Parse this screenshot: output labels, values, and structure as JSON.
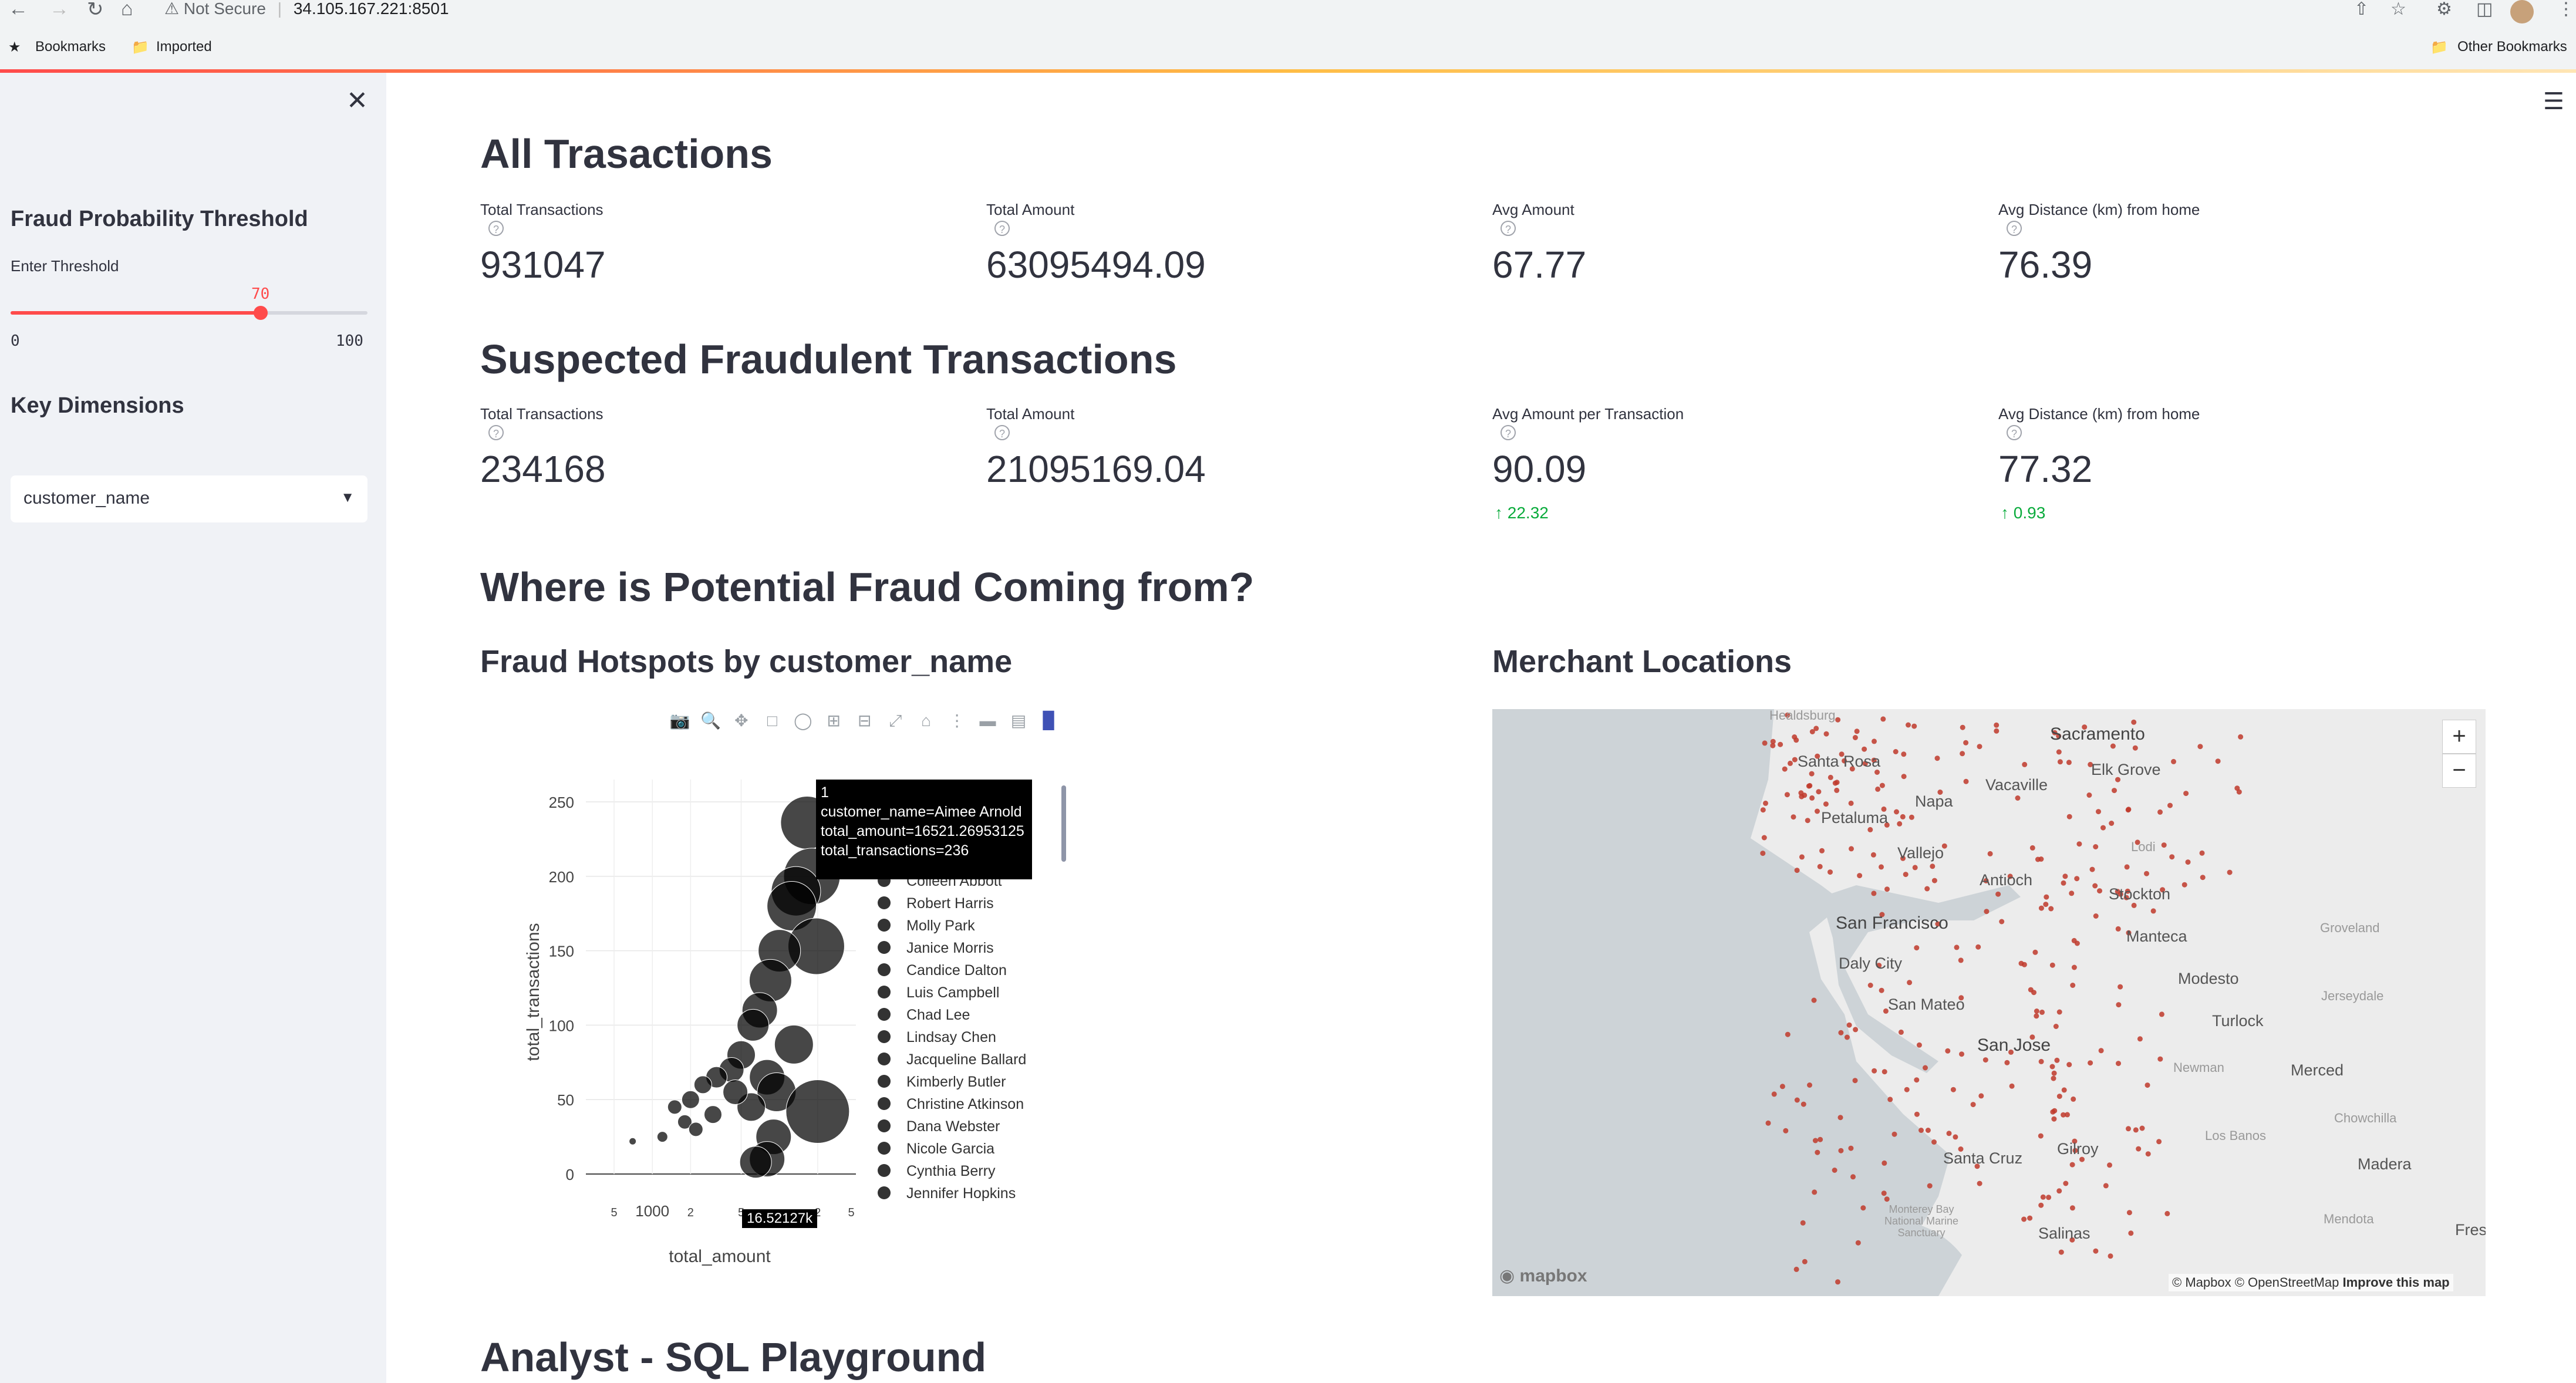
{
  "browser": {
    "security_label": "Not Secure",
    "url": "34.105.167.221:8501",
    "bookmarks": [
      "Bookmarks",
      "Imported"
    ],
    "other_bookmarks": "Other Bookmarks"
  },
  "sidebar": {
    "threshold_title": "Fraud Probability Threshold",
    "threshold_label": "Enter Threshold",
    "slider": {
      "value": "70",
      "min": "0",
      "max": "100",
      "fraction": 0.7
    },
    "dimensions_title": "Key Dimensions",
    "dimension_selected": "customer_name"
  },
  "all_transactions": {
    "title": "All Trasactions",
    "metrics": [
      {
        "label": "Total Transactions",
        "value": "931047"
      },
      {
        "label": "Total Amount",
        "value": "63095494.09"
      },
      {
        "label": "Avg Amount",
        "value": "67.77"
      },
      {
        "label": "Avg Distance (km) from home",
        "value": "76.39"
      }
    ]
  },
  "suspected": {
    "title": "Suspected Fraudulent Transactions",
    "metrics": [
      {
        "label": "Total Transactions",
        "value": "234168",
        "delta": ""
      },
      {
        "label": "Total Amount",
        "value": "21095169.04",
        "delta": ""
      },
      {
        "label": "Avg Amount per Transaction",
        "value": "90.09",
        "delta": "22.32"
      },
      {
        "label": "Avg Distance (km) from home",
        "value": "77.32",
        "delta": "0.93"
      }
    ]
  },
  "where_title": "Where is Potential Fraud Coming from?",
  "hotspots_title": "Fraud Hotspots by customer_name",
  "merchant_title": "Merchant Locations",
  "sql_title": "Analyst - SQL Playground",
  "tooltip": {
    "line1": "1",
    "line2": "customer_name=Aimee Arnold",
    "line3": "total_amount=16521.26953125",
    "line4": "total_transactions=236"
  },
  "hover_x_label": "16.52127k",
  "map": {
    "cities": [
      "Healdsburg",
      "Sacramento",
      "Santa Rosa",
      "Elk Grove",
      "Vacaville",
      "Napa",
      "Petaluma",
      "Vallejo",
      "Lodi",
      "Antioch",
      "Stockton",
      "San Francisco",
      "Manteca",
      "Daly City",
      "Groveland",
      "Modesto",
      "San Mateo",
      "Jerseydale",
      "Turlock",
      "San Jose",
      "Newman",
      "Merced",
      "Chowchilla",
      "Los Banos",
      "Gilroy",
      "Santa Cruz",
      "Madera",
      "Mendota",
      "Monterey Bay National Marine Sanctuary",
      "Salinas",
      "Fresno"
    ],
    "attribution": "© Mapbox © OpenStreetMap",
    "improve": "Improve this map",
    "logo": "mapbox",
    "zoom_in": "+",
    "zoom_out": "−",
    "dot_color": "#c0392b"
  },
  "chart_data": {
    "type": "scatter",
    "subtype": "bubble",
    "xlabel": "total_amount",
    "ylabel": "total_transactions",
    "x_scale": "log",
    "y_ticks": [
      0,
      50,
      100,
      150,
      200,
      250
    ],
    "x_tick_labels": [
      "5",
      "1000",
      "2",
      "5",
      "2",
      "5"
    ],
    "ylim": [
      0,
      265
    ],
    "marker_color": "#000000",
    "legend_visible": [
      "Colleen Abbott",
      "Robert Harris",
      "Molly Park",
      "Janice Morris",
      "Candice Dalton",
      "Luis Campbell",
      "Chad Lee",
      "Lindsay Chen",
      "Jacqueline Ballard",
      "Kimberly Butler",
      "Christine Atkinson",
      "Dana Webster",
      "Nicole Garcia",
      "Cynthia Berry",
      "Jennifer Hopkins"
    ],
    "points": [
      {
        "x": 16521,
        "y": 236,
        "size": 15
      },
      {
        "x": 18000,
        "y": 200,
        "size": 16
      },
      {
        "x": 13500,
        "y": 190,
        "size": 14
      },
      {
        "x": 12500,
        "y": 180,
        "size": 14
      },
      {
        "x": 19500,
        "y": 153,
        "size": 16
      },
      {
        "x": 10000,
        "y": 150,
        "size": 12
      },
      {
        "x": 8500,
        "y": 130,
        "size": 12
      },
      {
        "x": 7000,
        "y": 110,
        "size": 10
      },
      {
        "x": 6200,
        "y": 100,
        "size": 9
      },
      {
        "x": 13000,
        "y": 87,
        "size": 11
      },
      {
        "x": 5000,
        "y": 80,
        "size": 8
      },
      {
        "x": 4200,
        "y": 70,
        "size": 7
      },
      {
        "x": 3200,
        "y": 65,
        "size": 6
      },
      {
        "x": 8000,
        "y": 65,
        "size": 10
      },
      {
        "x": 2500,
        "y": 60,
        "size": 5
      },
      {
        "x": 2000,
        "y": 50,
        "size": 5
      },
      {
        "x": 1500,
        "y": 45,
        "size": 4
      },
      {
        "x": 9500,
        "y": 55,
        "size": 11
      },
      {
        "x": 20000,
        "y": 42,
        "size": 18
      },
      {
        "x": 3000,
        "y": 40,
        "size": 5
      },
      {
        "x": 1800,
        "y": 35,
        "size": 4
      },
      {
        "x": 6000,
        "y": 45,
        "size": 8
      },
      {
        "x": 9000,
        "y": 25,
        "size": 10
      },
      {
        "x": 8000,
        "y": 10,
        "size": 10
      },
      {
        "x": 6500,
        "y": 8,
        "size": 9
      },
      {
        "x": 1200,
        "y": 25,
        "size": 3
      },
      {
        "x": 700,
        "y": 22,
        "size": 2
      },
      {
        "x": 2200,
        "y": 30,
        "size": 4
      },
      {
        "x": 4500,
        "y": 55,
        "size": 7
      }
    ]
  }
}
